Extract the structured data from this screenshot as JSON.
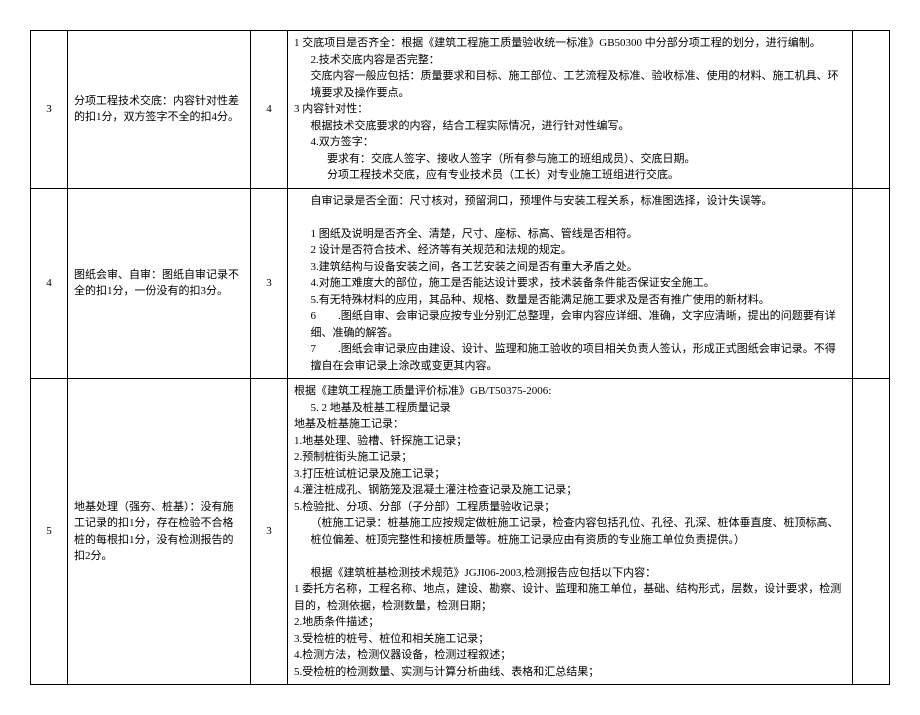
{
  "rows": [
    {
      "num": "3",
      "desc": "分项工程技术交底：内容针对性差的扣1分，双方签字不全的扣4分。",
      "score": "4",
      "detail": [
        {
          "cls": "block",
          "t": "1 交底项目是否齐全：根据《建筑工程施工质量验收统一标准》GB50300 中分部分项工程的划分，进行编制。"
        },
        {
          "cls": "indent1",
          "t": "2.技术交底内容是否完整："
        },
        {
          "cls": "indent1",
          "t": "交底内容一般应包括：质量要求和目标、施工部位、工艺流程及标准、验收标准、使用的材料、施工机具、环境要求及操作要点。"
        },
        {
          "cls": "block",
          "t": "3 内容针对性："
        },
        {
          "cls": "indent1",
          "t": "根据技术交底要求的内容，结合工程实际情况，进行针对性编写。"
        },
        {
          "cls": "indent1",
          "t": "4.双方签字："
        },
        {
          "cls": "indent2",
          "t": "要求有：交底人签字、接收人签字（所有参与施工的班组成员）、交底日期。"
        },
        {
          "cls": "indent2",
          "t": "分项工程技术交底，应有专业技术员（工长）对专业施工班组进行交底。"
        }
      ]
    },
    {
      "num": "4",
      "desc": "图纸会审、自审：图纸自审记录不全的扣1分，一份没有的扣3分。",
      "score": "3",
      "detail": [
        {
          "cls": "indent1",
          "t": "自审记录是否全面：尺寸核对，预留洞口，预埋件与安装工程关系，标准图选择，设计失误等。"
        },
        {
          "cls": "block",
          "t": " "
        },
        {
          "cls": "indent1",
          "t": "1 图纸及说明是否齐全、清楚，尺寸、座标、标高、管线是否相符。"
        },
        {
          "cls": "indent1",
          "t": "2 设计是否符合技术、经济等有关规范和法规的规定。"
        },
        {
          "cls": "indent1",
          "t": "3.建筑结构与设备安装之间，各工艺安装之间是否有重大矛盾之处。"
        },
        {
          "cls": "indent1",
          "t": "4.对施工难度大的部位，施工是否能达设计要求，技术装备条件能否保证安全施工。"
        },
        {
          "cls": "indent1",
          "t": "5.有无特殊材料的应用，其品种、规格、数量是否能满足施工要求及是否有推广使用的新材料。"
        },
        {
          "cls": "indent1",
          "t": "6　　.图纸自审、会审记录应按专业分别汇总整理，会审内容应详细、准确，文字应清晰，提出的问题要有详细、准确的解答。"
        },
        {
          "cls": "indent1",
          "t": "7　　.图纸会审记录应由建设、设计、监理和施工验收的项目相关负责人签认，形成正式图纸会审记录。不得擅自在会审记录上涂改或变更其内容。"
        }
      ]
    },
    {
      "num": "5",
      "desc": "地基处理（强夯、桩基）：没有施工记录的扣1分，存在检验不合格桩的每根扣1分，没有检测报告的扣2分。",
      "score": "3",
      "detail": [
        {
          "cls": "block",
          "t": "根据《建筑工程施工质量评价标准》GB/T50375-2006:"
        },
        {
          "cls": "indent1",
          "t": "5. 2 地基及桩基工程质量记录"
        },
        {
          "cls": "block",
          "t": "地基及桩基施工记录："
        },
        {
          "cls": "block",
          "t": "1.地基处理、验槽、钎探施工记录；"
        },
        {
          "cls": "block",
          "t": "2.预制桩街头施工记录；"
        },
        {
          "cls": "block",
          "t": "3.打压桩试桩记录及施工记录；"
        },
        {
          "cls": "block",
          "t": "4.灌注桩成孔、钢筋笼及混凝土灌注检查记录及施工记录；"
        },
        {
          "cls": "block",
          "t": "5.检验批、分项、分部（子分部）工程质量验收记录；"
        },
        {
          "cls": "indent1",
          "t": "（桩施工记录：桩基施工应按规定做桩施工记录，检查内容包括孔位、孔径、孔深、桩体垂直度、桩顶标高、桩位偏差、桩顶完整性和接桩质量等。桩施工记录应由有资质的专业施工单位负责提供。）"
        },
        {
          "cls": "block",
          "t": " "
        },
        {
          "cls": "indent1",
          "t": "根据《建筑桩基检测技术规范》JGJI06-2003,检测报告应包括以下内容："
        },
        {
          "cls": "block",
          "t": "1 委托方名称，工程名称、地点，建设、勘察、设计、监理和施工单位，基础、结构形式，层数，设计要求，检测目的，检测依据，检测数量，检测日期；"
        },
        {
          "cls": "block",
          "t": "2.地质条件描述；"
        },
        {
          "cls": "block",
          "t": "3.受检桩的桩号、桩位和相关施工记录；"
        },
        {
          "cls": "block",
          "t": "4.检测方法，检测仪器设备，检测过程叙述；"
        },
        {
          "cls": "block",
          "t": "5.受检桩的检测数量、实测与计算分析曲线、表格和汇总结果；"
        }
      ]
    }
  ]
}
